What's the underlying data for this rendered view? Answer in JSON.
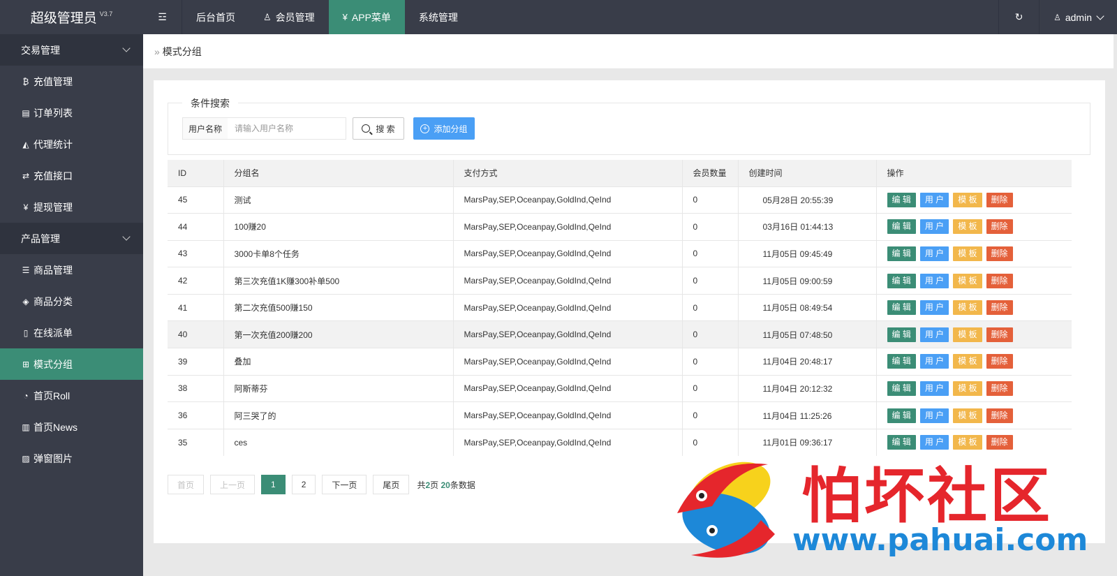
{
  "brand": {
    "name": "超级管理员",
    "version": "V3.7"
  },
  "topnav": {
    "toggle_icon": "☲",
    "items": [
      {
        "label": "后台首页",
        "icon": ""
      },
      {
        "label": "会员管理",
        "icon": "♙"
      },
      {
        "label": "APP菜单",
        "icon": "¥",
        "active": true
      },
      {
        "label": "系统管理",
        "icon": ""
      }
    ],
    "refresh_icon": "↻",
    "user": "admin"
  },
  "sidebar": {
    "groups": [
      {
        "title": "交易管理",
        "items": [
          {
            "label": "充值管理",
            "icon": "₿"
          },
          {
            "label": "订单列表",
            "icon": "▤"
          },
          {
            "label": "代理统计",
            "icon": "◭"
          },
          {
            "label": "充值接口",
            "icon": "⇄"
          },
          {
            "label": "提现管理",
            "icon": "¥"
          }
        ]
      },
      {
        "title": "产品管理",
        "items": [
          {
            "label": "商品管理",
            "icon": "☰"
          },
          {
            "label": "商品分类",
            "icon": "◈"
          },
          {
            "label": "在线派单",
            "icon": "▯"
          },
          {
            "label": "模式分组",
            "icon": "⊞",
            "active": true
          },
          {
            "label": "首页Roll",
            "icon": "◔"
          },
          {
            "label": "首页News",
            "icon": "▥"
          },
          {
            "label": "弹窗图片",
            "icon": "▨"
          }
        ]
      }
    ]
  },
  "breadcrumb": {
    "sep": "»",
    "current": "模式分组"
  },
  "search": {
    "legend": "条件搜索",
    "label": "用户名称",
    "placeholder": "请输入用户名称",
    "value": "",
    "search_btn": "搜 索",
    "add_btn": "添加分组"
  },
  "table": {
    "headers": [
      "ID",
      "分组名",
      "支付方式",
      "会员数量",
      "创建时间",
      "操作"
    ],
    "rows": [
      {
        "id": "45",
        "name": "测试",
        "pay": "MarsPay,SEP,Oceanpay,GoldInd,QeInd",
        "count": "0",
        "time": "05月28日 20:55:39"
      },
      {
        "id": "44",
        "name": "100赚20",
        "pay": "MarsPay,SEP,Oceanpay,GoldInd,QeInd",
        "count": "0",
        "time": "03月16日 01:44:13"
      },
      {
        "id": "43",
        "name": "3000卡单8个任务",
        "pay": "MarsPay,SEP,Oceanpay,GoldInd,QeInd",
        "count": "0",
        "time": "11月05日 09:45:49"
      },
      {
        "id": "42",
        "name": "第三次充值1K赚300补单500",
        "pay": "MarsPay,SEP,Oceanpay,GoldInd,QeInd",
        "count": "0",
        "time": "11月05日 09:00:59"
      },
      {
        "id": "41",
        "name": "第二次充值500赚150",
        "pay": "MarsPay,SEP,Oceanpay,GoldInd,QeInd",
        "count": "0",
        "time": "11月05日 08:49:54"
      },
      {
        "id": "40",
        "name": "第一次充值200赚200",
        "pay": "MarsPay,SEP,Oceanpay,GoldInd,QeInd",
        "count": "0",
        "time": "11月05日 07:48:50"
      },
      {
        "id": "39",
        "name": "叠加",
        "pay": "MarsPay,SEP,Oceanpay,GoldInd,QeInd",
        "count": "0",
        "time": "11月04日 20:48:17"
      },
      {
        "id": "38",
        "name": "阿斯蒂芬",
        "pay": "MarsPay,SEP,Oceanpay,GoldInd,QeInd",
        "count": "0",
        "time": "11月04日 20:12:32"
      },
      {
        "id": "36",
        "name": "阿三哭了的",
        "pay": "MarsPay,SEP,Oceanpay,GoldInd,QeInd",
        "count": "0",
        "time": "11月04日 11:25:26"
      },
      {
        "id": "35",
        "name": "ces",
        "pay": "MarsPay,SEP,Oceanpay,GoldInd,QeInd",
        "count": "0",
        "time": "11月01日 09:36:17"
      }
    ],
    "actions": {
      "edit": "编 辑",
      "user": "用 户",
      "tpl": "模 板",
      "del": "删除"
    }
  },
  "pager": {
    "first": "首页",
    "prev": "上一页",
    "pages": [
      "1",
      "2"
    ],
    "current": "1",
    "next": "下一页",
    "last": "尾页",
    "info_prefix": "共",
    "total_pages": "2",
    "info_mid": "页 ",
    "total_records": "20",
    "info_suffix": "条数据"
  },
  "watermark": {
    "title": "怕坏社区",
    "url": "www.pahuai.com"
  },
  "colors": {
    "sidebar_bg": "#393d49",
    "accent": "#3b8d76",
    "blue": "#4a9ff5",
    "yellow": "#f2b74b",
    "red": "#e4603a"
  }
}
